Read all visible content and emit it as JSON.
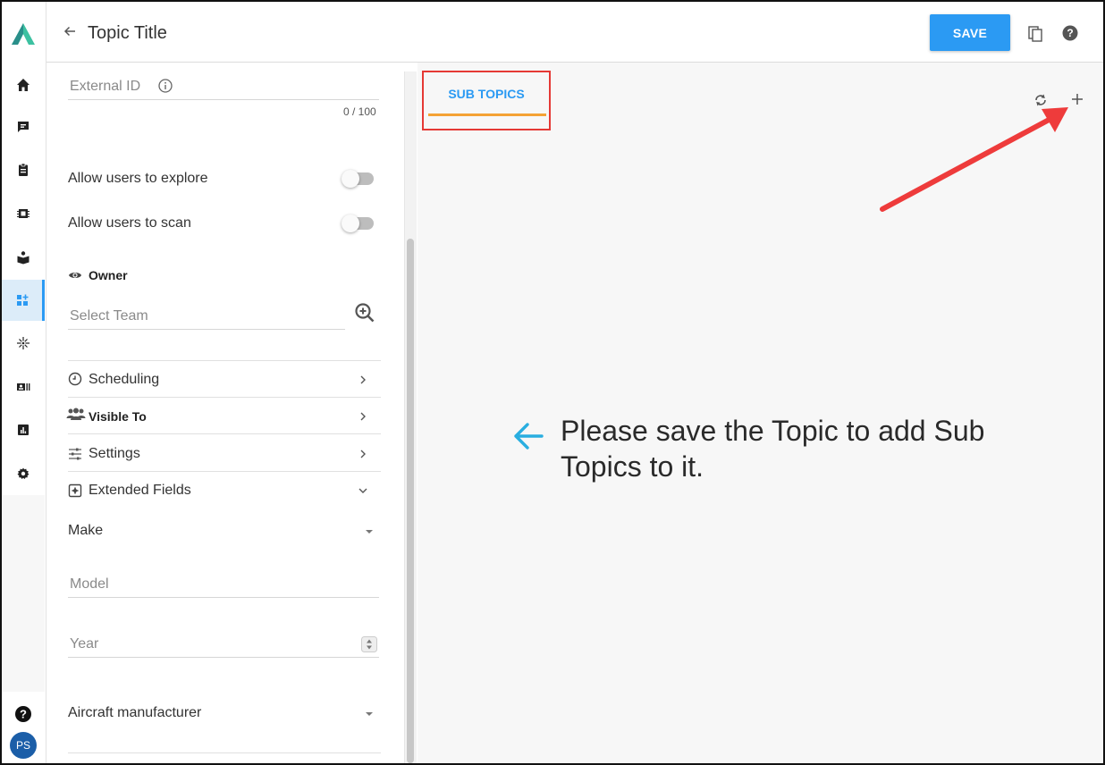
{
  "header": {
    "title": "Topic Title",
    "save_label": "SAVE"
  },
  "nav": {
    "active_index": 5,
    "avatar_initials": "PS",
    "items": [
      "home-icon",
      "chat-icon",
      "clipboard-icon",
      "chip-icon",
      "book-icon",
      "dashboard-add-icon",
      "sparkle-icon",
      "id-card-icon",
      "chart-icon",
      "gear-icon"
    ]
  },
  "form": {
    "external_id": {
      "label": "External ID",
      "counter": "0 / 100"
    },
    "toggles": [
      {
        "label": "Allow users to explore",
        "on": false
      },
      {
        "label": "Allow users to scan",
        "on": false
      }
    ],
    "owner": {
      "label": "Owner",
      "placeholder": "Select Team"
    },
    "sections": [
      {
        "label": "Scheduling",
        "icon": "clock-icon",
        "expanded": false
      },
      {
        "label": "Visible To",
        "icon": "people-icon",
        "expanded": false
      },
      {
        "label": "Settings",
        "icon": "sliders-icon",
        "expanded": false
      },
      {
        "label": "Extended Fields",
        "icon": "extended-fields-icon",
        "expanded": true
      }
    ],
    "extended": {
      "make_label": "Make",
      "model_label": "Model",
      "year_label": "Year",
      "aircraft_label": "Aircraft manufacturer"
    }
  },
  "content": {
    "tab_label": "SUB TOPICS",
    "message": "Please save the Topic to add Sub Topics to it."
  },
  "colors": {
    "accent": "#2b9af3",
    "tab_underline": "#f4a234",
    "highlight": "#e53935",
    "hint_arrow": "#29aee0"
  }
}
